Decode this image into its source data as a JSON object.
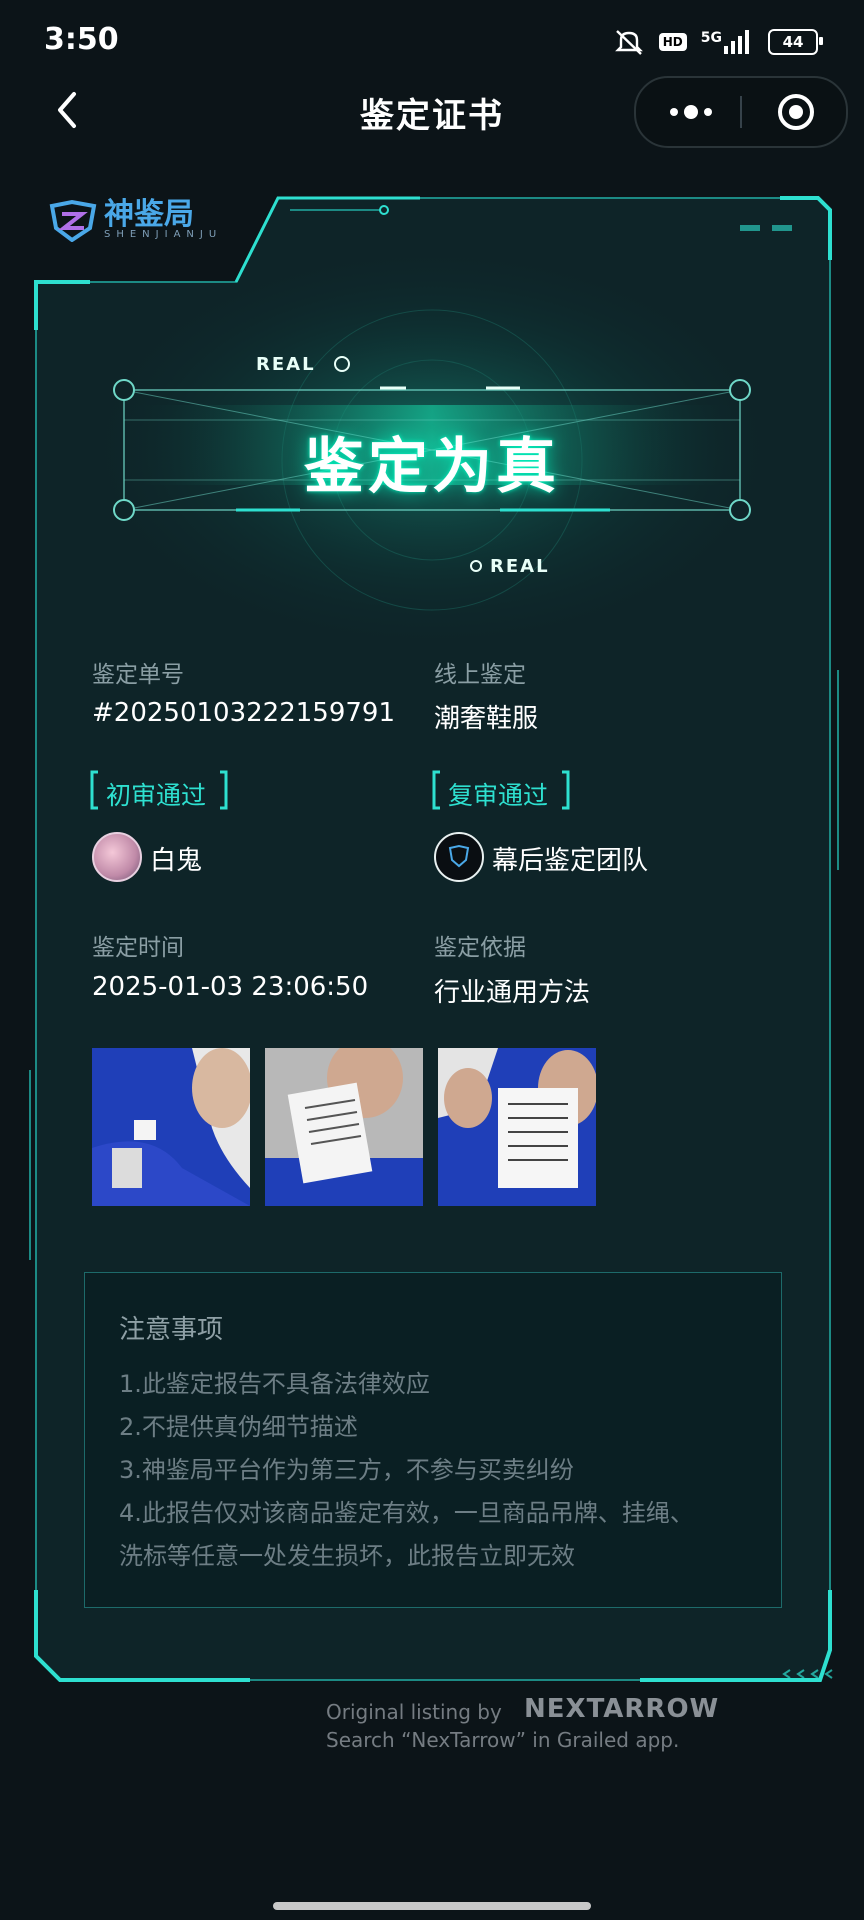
{
  "status_bar": {
    "time": "3:50",
    "hd": "HD",
    "network": "5G",
    "battery": "44"
  },
  "nav": {
    "title": "鉴定证书"
  },
  "brand": {
    "name": "神鉴局",
    "sub": "SHENJIANJU"
  },
  "hero": {
    "title": "鉴定为真",
    "tag_top": "REAL",
    "tag_bottom": "REAL"
  },
  "info": {
    "order_label": "鉴定单号",
    "order_value": "#20250103222159791",
    "category_label": "线上鉴定",
    "category_value": "潮奢鞋服",
    "first_review": "初审通过",
    "first_reviewer": "白鬼",
    "second_review": "复审通过",
    "second_reviewer": "幕后鉴定团队",
    "time_label": "鉴定时间",
    "time_value": "2025-01-03 23:06:50",
    "basis_label": "鉴定依据",
    "basis_value": "行业通用方法"
  },
  "notice": {
    "title": "注意事项",
    "items": [
      "1.此鉴定报告不具备法律效应",
      "2.不提供真伪细节描述",
      "3.神鉴局平台作为第三方，不参与买卖纠纷",
      "4.此报告仅对该商品鉴定有效，一旦商品吊牌、挂绳、",
      "洗标等任意一处发生损坏，此报告立即无效"
    ]
  },
  "watermark": {
    "line1": "Original listing by",
    "brand": "NEXTARROW",
    "line2": "Search “NexTarrow” in Grailed app."
  },
  "colors": {
    "accent": "#2ee0d0",
    "background": "#0c1418",
    "card": "#0e2428"
  }
}
